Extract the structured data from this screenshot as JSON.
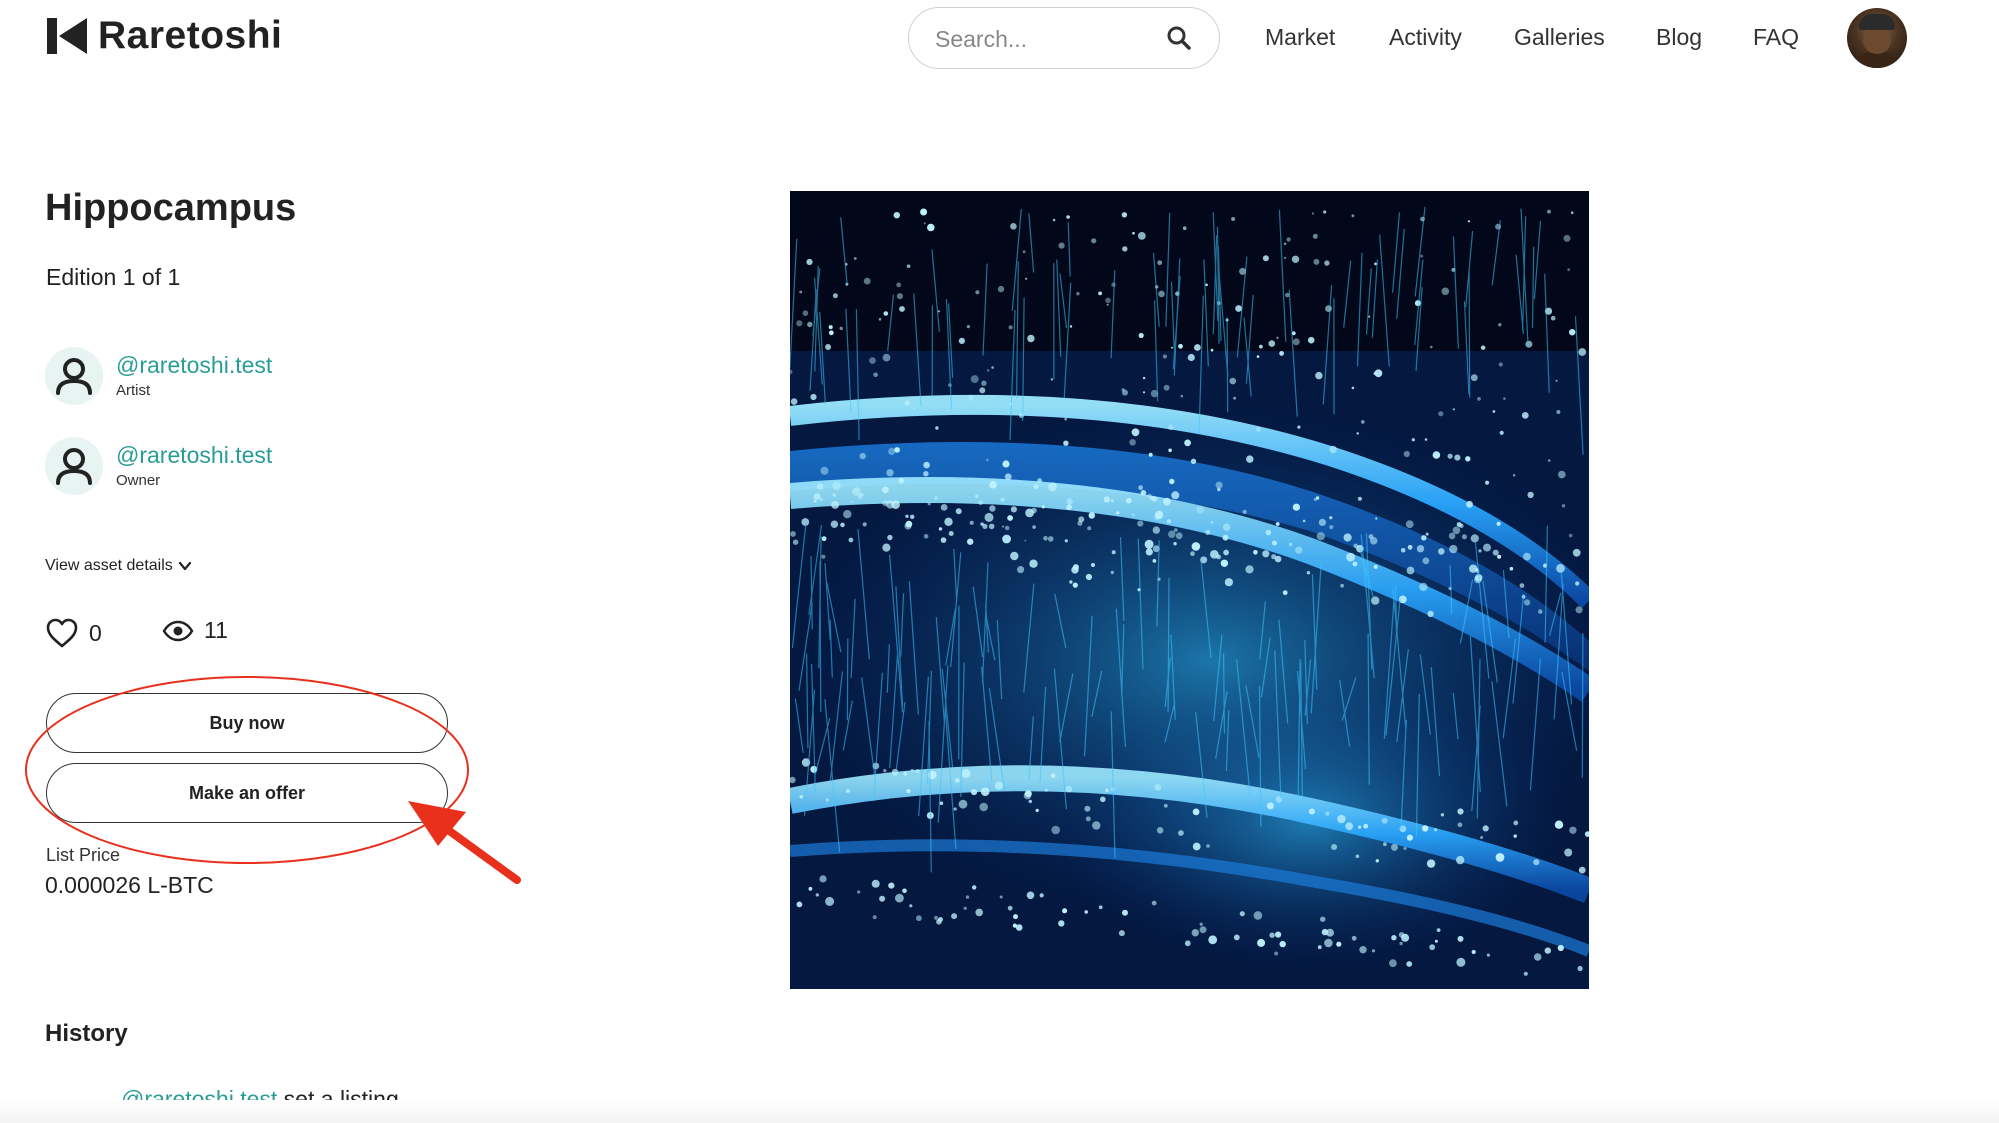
{
  "header": {
    "logo_text": "Raretoshi",
    "search": {
      "placeholder": "Search...",
      "value": ""
    },
    "nav": [
      {
        "label": "Market"
      },
      {
        "label": "Activity"
      },
      {
        "label": "Galleries"
      },
      {
        "label": "Blog"
      },
      {
        "label": "FAQ"
      }
    ]
  },
  "asset": {
    "title": "Hippocampus",
    "edition": "Edition 1 of 1",
    "people": [
      {
        "handle": "@raretoshi.test",
        "role": "Artist"
      },
      {
        "handle": "@raretoshi.test",
        "role": "Owner"
      }
    ],
    "details_toggle": "View asset details",
    "likes": "0",
    "views": "11",
    "buy_label": "Buy now",
    "offer_label": "Make an offer",
    "list_price_label": "List Price",
    "list_price_value": "0.000026 L-BTC"
  },
  "history": {
    "title": "History",
    "entries": [
      {
        "user": "@raretoshi.test",
        "action": " set a listing"
      }
    ]
  },
  "colors": {
    "link_teal": "#2a9d96",
    "annotation_red": "#e8301c",
    "art_background": "#02081a",
    "art_glow": "#1fb8ff"
  },
  "icons": [
    "logo-mark-icon",
    "search-icon",
    "user-icon",
    "chevron-down-icon",
    "heart-icon",
    "eye-icon"
  ]
}
